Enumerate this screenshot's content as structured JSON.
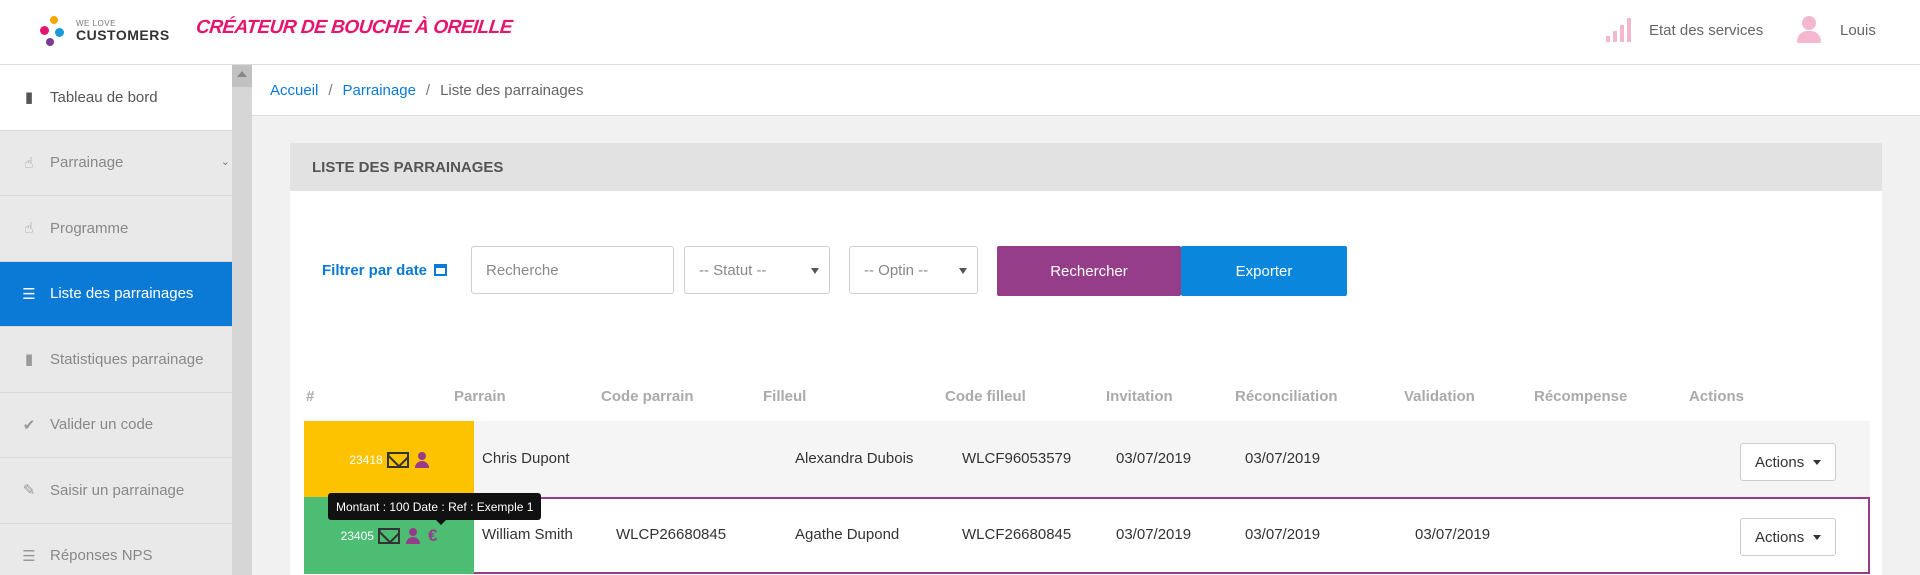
{
  "header": {
    "logo_small": "WE LOVE",
    "logo_big": "CUSTOMERS",
    "tagline": "CRÉATEUR DE BOUCHE À OREILLE",
    "status_label": "Etat des services",
    "user_name": "Louis",
    "accent_color": "#e6156e"
  },
  "sidebar": {
    "items": [
      {
        "label": "Tableau de bord",
        "icon": "bar-chart-icon"
      },
      {
        "label": "Parrainage",
        "icon": "thumbs-up-icon"
      },
      {
        "label": "Programme",
        "icon": "thumbs-up-icon"
      },
      {
        "label": "Liste des parrainages",
        "icon": "list-icon"
      },
      {
        "label": "Statistiques parrainage",
        "icon": "bar-chart-icon"
      },
      {
        "label": "Valider un code",
        "icon": "check-icon"
      },
      {
        "label": "Saisir un parrainage",
        "icon": "pencil-icon"
      },
      {
        "label": "Réponses NPS",
        "icon": "list-icon"
      }
    ],
    "active_color": "#0a7ad6"
  },
  "breadcrumb": {
    "home": "Accueil",
    "section": "Parrainage",
    "current": "Liste des parrainages",
    "sep": "/"
  },
  "panel": {
    "title": "LISTE DES PARRAINAGES"
  },
  "filters": {
    "date_label": "Filtrer par date",
    "search_placeholder": "Recherche",
    "status_value": "-- Statut --",
    "optin_value": "-- Optin --",
    "search_button": "Rechercher",
    "export_button": "Exporter"
  },
  "table": {
    "headers": [
      "#",
      "Parrain",
      "Code parrain",
      "Filleul",
      "Code filleul",
      "Invitation",
      "Réconciliation",
      "Validation",
      "Récompense",
      "Actions"
    ],
    "rows": [
      {
        "id": "23418",
        "parrain": "Chris Dupont",
        "code_parrain": "",
        "filleul": "Alexandra Dubois",
        "code_filleul": "WLCF96053579",
        "invitation": "03/07/2019",
        "reconciliation": "03/07/2019",
        "validation": "",
        "recompense": "",
        "actions": "Actions",
        "status_color": "#fdc200"
      },
      {
        "id": "23405",
        "parrain": "William Smith",
        "code_parrain": "WLCP26680845",
        "filleul": "Agathe Dupond",
        "code_filleul": "WLCF26680845",
        "invitation": "03/07/2019",
        "reconciliation": "03/07/2019",
        "validation": "03/07/2019",
        "recompense": "",
        "actions": "Actions",
        "euro": "€",
        "status_color": "#4dbd74"
      }
    ]
  },
  "tooltip": "Montant : 100 Date : Ref : Exemple 1"
}
